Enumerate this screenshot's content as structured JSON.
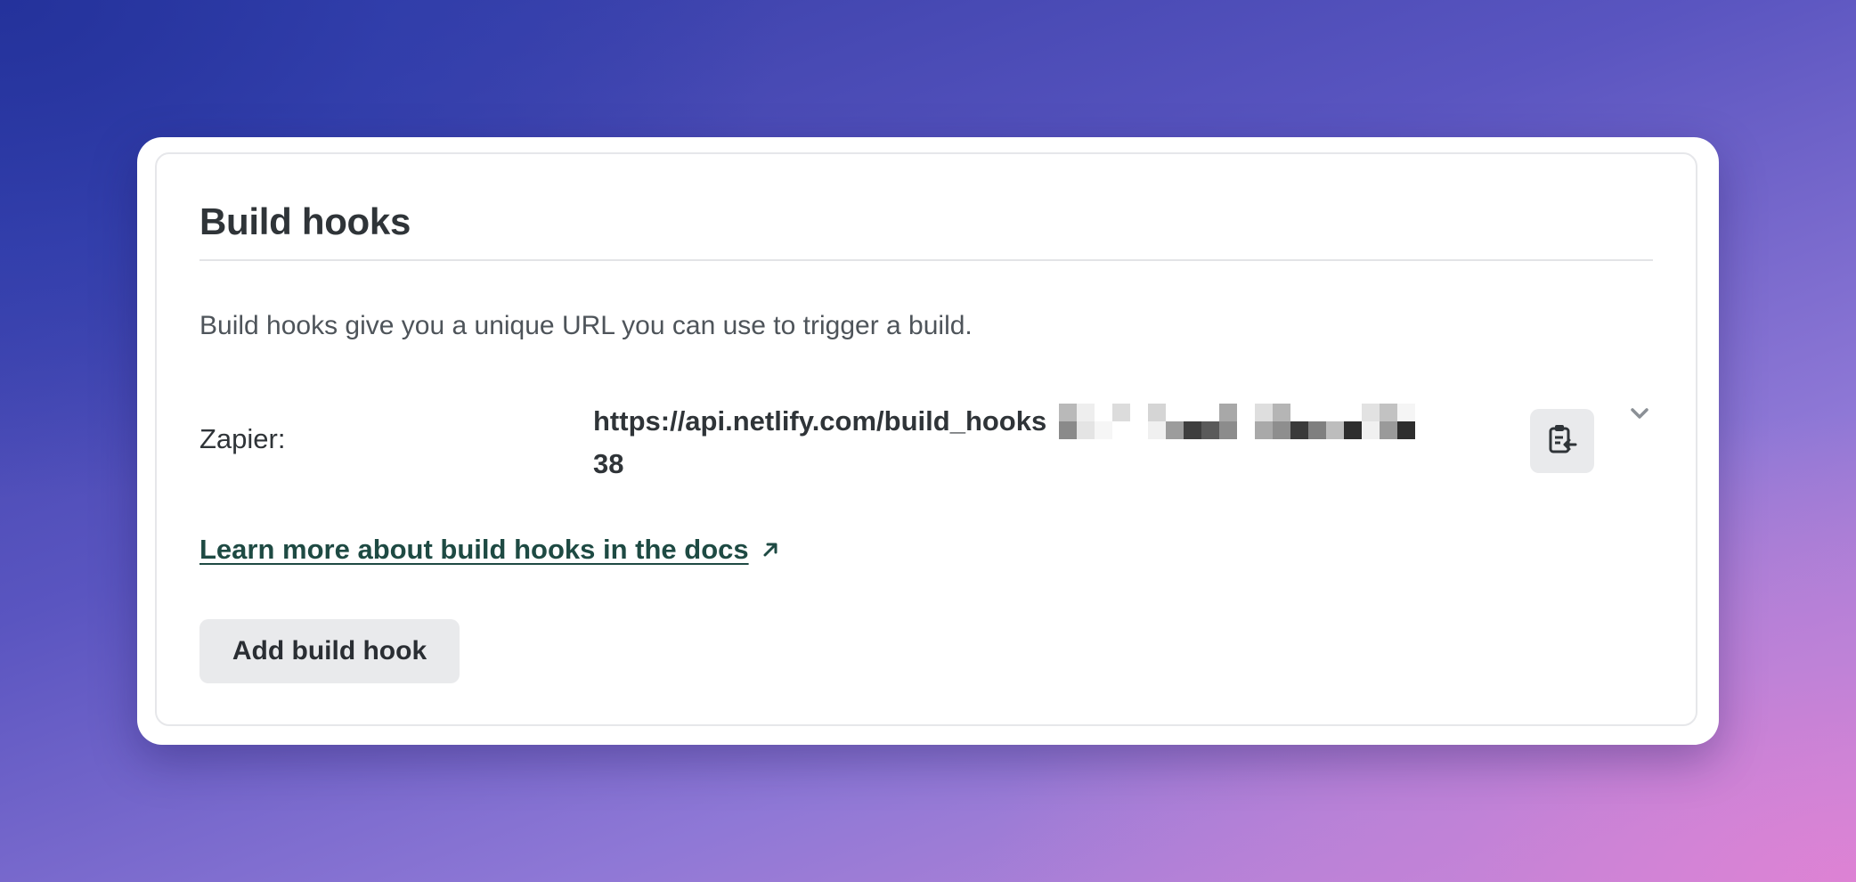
{
  "section": {
    "title": "Build hooks",
    "description": "Build hooks give you a unique URL you can use to trigger a build."
  },
  "hooks": [
    {
      "label": "Zapier:",
      "url_visible": "https://api.netlify.com/build_hooks",
      "url_suffix": "38",
      "url_redacted": true
    }
  ],
  "docs_link": {
    "text": "Learn more about build hooks in the docs",
    "icon": "external-arrow-icon"
  },
  "actions": {
    "add_label": "Add build hook",
    "copy_icon": "clipboard-copy-icon",
    "expand_icon": "chevron-down-icon"
  },
  "colors": {
    "link": "#1e4a43",
    "text": "#2f3438",
    "muted_text": "#4e545a",
    "button_bg": "#e9eaec"
  }
}
